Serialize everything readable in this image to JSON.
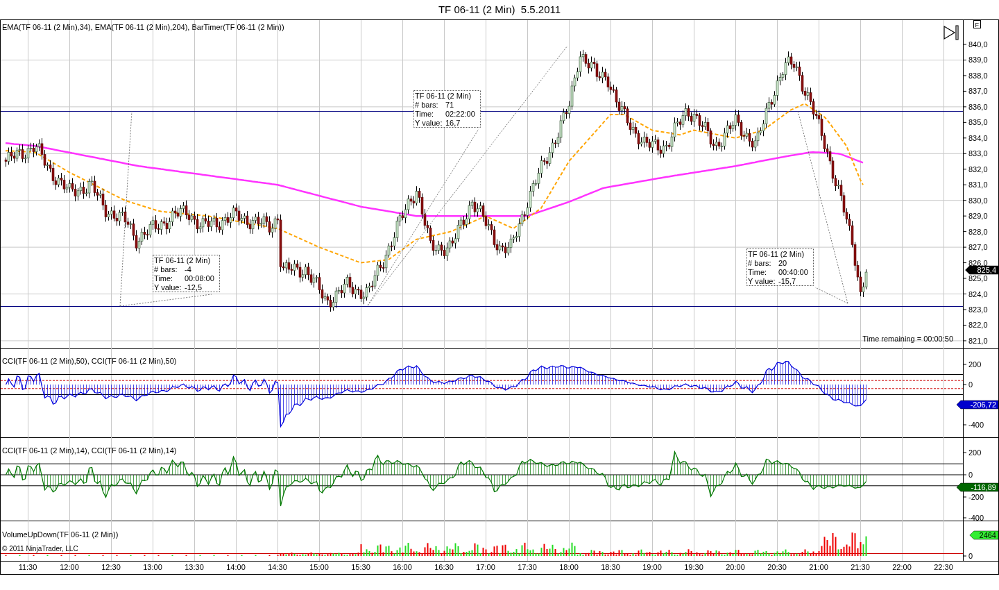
{
  "title": "TF 06-11 (2 Min)  5.5.2011",
  "flag_button": "F",
  "panels": [
    {
      "kind": "price",
      "legend": "EMA(TF 06-11 (2 Min),34), EMA(TF 06-11 (2 Min),204), BarTimer(TF 06-11 (2 Min))",
      "axis_labels": [
        "840,0",
        "839,0",
        "838,0",
        "837,0",
        "836,0",
        "835,0",
        "834,0",
        "833,0",
        "832,0",
        "831,0",
        "830,0",
        "829,0",
        "828,0",
        "827,0",
        "826,0",
        "825,0",
        "824,0",
        "823,0",
        "822,0",
        "821,0"
      ],
      "readout": "825,4"
    },
    {
      "kind": "cci50",
      "legend": "CCI(TF 06-11 (2 Min),50), CCI(TF 06-11 (2 Min),50)",
      "axis_labels": [
        "200",
        "0",
        "-400"
      ],
      "readout": "-206,72"
    },
    {
      "kind": "cci14",
      "legend": "CCI(TF 06-11 (2 Min),14), CCI(TF 06-11 (2 Min),14)",
      "axis_labels": [
        "200",
        "0",
        "-200",
        "-400"
      ],
      "readout": "-116,89"
    },
    {
      "kind": "volume",
      "legend": "VolumeUpDown(TF 06-11 (2 Min))",
      "axis_labels": [
        "0"
      ],
      "readout": "2464"
    }
  ],
  "measurements": [
    {
      "instrument": "TF 06-11 (2 Min)",
      "fields": [
        {
          "label": "# bars:",
          "value": "-4"
        },
        {
          "label": "Time:",
          "value": "00:08:00"
        },
        {
          "label": "Y value:",
          "value": "-12,5"
        }
      ]
    },
    {
      "instrument": "TF 06-11 (2 Min)",
      "fields": [
        {
          "label": "# bars:",
          "value": "71"
        },
        {
          "label": "Time:",
          "value": "02:22:00"
        },
        {
          "label": "Y value:",
          "value": "16,7"
        }
      ]
    },
    {
      "instrument": "TF 06-11 (2 Min)",
      "fields": [
        {
          "label": "# bars:",
          "value": "20"
        },
        {
          "label": "Time:",
          "value": "00:40:00"
        },
        {
          "label": "Y value:",
          "value": "-15,7"
        }
      ]
    }
  ],
  "bar_timer": "Time remaining = 00:00:50",
  "copyright": "© 2011 NinjaTrader, LLC",
  "time_axis": [
    "11:30",
    "12:00",
    "12:30",
    "13:00",
    "13:30",
    "14:00",
    "14:30",
    "15:00",
    "15:30",
    "16:00",
    "16:30",
    "17:00",
    "17:30",
    "18:00",
    "18:30",
    "19:00",
    "19:30",
    "20:00",
    "20:30",
    "21:00",
    "21:30",
    "22:00",
    "22:30"
  ]
}
